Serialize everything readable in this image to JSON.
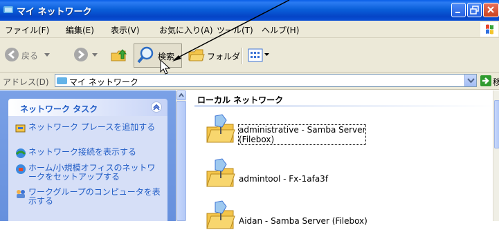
{
  "window": {
    "title": "マイ ネットワーク"
  },
  "menu": [
    "ファイル(F)",
    "編集(E)",
    "表示(V)",
    "お気に入り(A)",
    "ツール(T)",
    "ヘルプ(H)"
  ],
  "toolbar": {
    "back": "戻る",
    "search": "検索",
    "folders": "フォルダ"
  },
  "address": {
    "label": "アドレス(D)",
    "value": "マイ ネットワーク",
    "go": "移動"
  },
  "task_pane": {
    "title": "ネットワーク タスク",
    "items": [
      {
        "label": "ネットワーク プレースを追加する",
        "icon": "add-place-icon"
      },
      {
        "label": "ネットワーク接続を表示する",
        "icon": "network-connections-icon"
      },
      {
        "label": "ホーム/小規模オフィスのネットワークをセットアップする",
        "icon": "home-network-icon"
      },
      {
        "label": "ワークグループのコンピュータを表示する",
        "icon": "workgroup-icon"
      }
    ]
  },
  "content": {
    "group": "ローカル ネットワーク",
    "shares": [
      {
        "line1": "administrative - Samba Server",
        "line2": "(Filebox)"
      },
      {
        "line1": "admintool - Fx-1afa3f",
        "line2": ""
      },
      {
        "line1": "Aidan - Samba Server (Filebox)",
        "line2": ""
      }
    ]
  },
  "colors": {
    "titlebar": "#0a5fd9",
    "taskpane": "#6f97e0",
    "link": "#215dc6"
  }
}
